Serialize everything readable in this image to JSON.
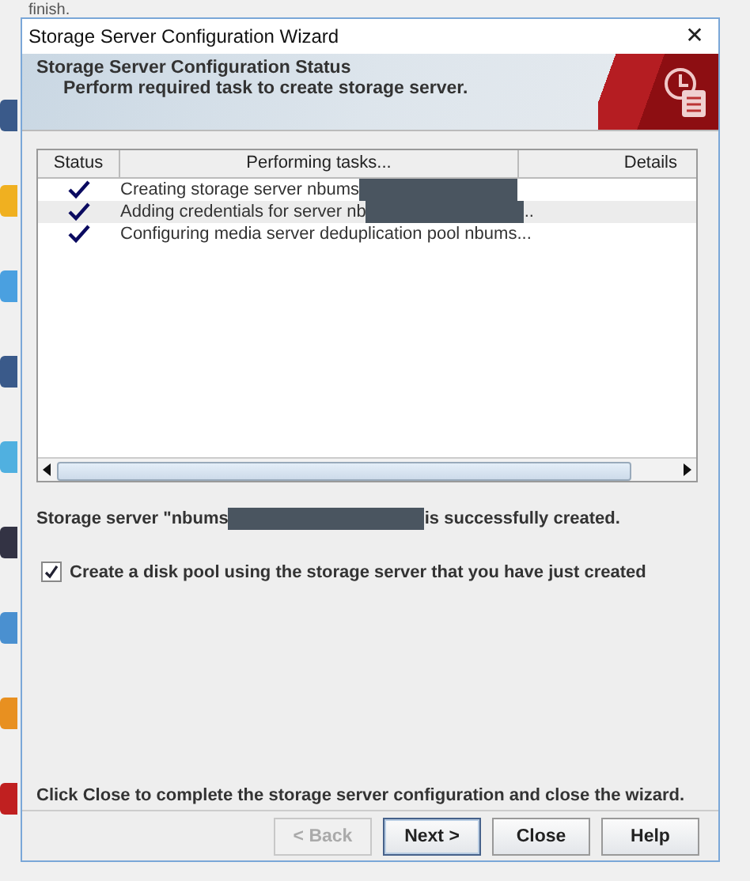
{
  "background": {
    "text": "finish."
  },
  "window": {
    "title": "Storage Server Configuration Wizard",
    "close": "✕"
  },
  "banner": {
    "title": "Storage Server Configuration Status",
    "subtitle": "Perform required task to create storage server."
  },
  "table": {
    "columns": [
      "Status",
      "Performing tasks...",
      "Details"
    ],
    "rows": [
      {
        "done": true,
        "task": "Creating storage server nbums",
        "redacted": true,
        "tail": "",
        "selected": false
      },
      {
        "done": true,
        "task": "Adding credentials for server nb",
        "redacted": true,
        "tail": "..",
        "selected": true
      },
      {
        "done": true,
        "task": "Configuring media server deduplication pool nbums...",
        "redacted": false,
        "tail": "",
        "selected": false
      }
    ]
  },
  "status_message": {
    "before": "Storage server \"nbums",
    "redacted": true,
    "after": "is successfully created."
  },
  "disk_pool": {
    "label": "Create a disk pool using the storage server that you have just created",
    "checked": true
  },
  "footer_text": "Click Close to complete the storage server configuration and close the wizard.",
  "buttons": [
    {
      "label": "< Back",
      "disabled": true,
      "default": false
    },
    {
      "label": "Next >",
      "disabled": false,
      "default": true
    },
    {
      "label": "Close",
      "disabled": false,
      "default": false
    },
    {
      "label": "Help",
      "disabled": false,
      "default": false
    }
  ]
}
